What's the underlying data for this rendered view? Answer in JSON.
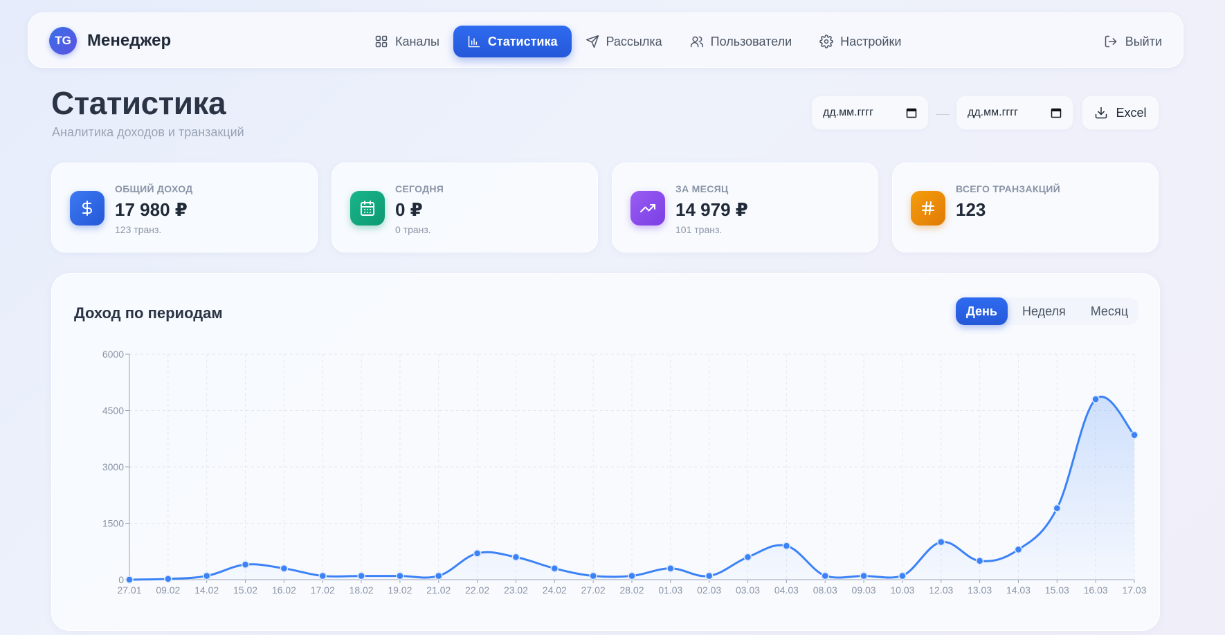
{
  "nav": {
    "logo": "TG",
    "app_name": "Менеджер",
    "items": [
      {
        "label": "Каналы",
        "icon": "grid-icon"
      },
      {
        "label": "Статистика",
        "icon": "bar-chart-icon",
        "active": true
      },
      {
        "label": "Рассылка",
        "icon": "send-icon"
      },
      {
        "label": "Пользователи",
        "icon": "users-icon"
      },
      {
        "label": "Настройки",
        "icon": "gear-icon"
      }
    ],
    "logout": "Выйти"
  },
  "header": {
    "title": "Статистика",
    "subtitle": "Аналитика доходов и транзакций",
    "date_from_placeholder": "дд.мм.гггг",
    "date_to_placeholder": "дд.мм.гггг",
    "export_label": "Excel"
  },
  "stats": [
    {
      "label": "ОБЩИЙ ДОХОД",
      "value": "17 980 ₽",
      "sub": "123 транз.",
      "icon": "dollar-icon",
      "color": "#2f6bf0"
    },
    {
      "label": "СЕГОДНЯ",
      "value": "0 ₽",
      "sub": "0 транз.",
      "icon": "calendar-icon",
      "color": "#14a87e"
    },
    {
      "label": "ЗА МЕСЯЦ",
      "value": "14 979 ₽",
      "sub": "101 транз.",
      "icon": "trending-up-icon",
      "color": "#8a4cec"
    },
    {
      "label": "ВСЕГО ТРАНЗАКЦИЙ",
      "value": "123",
      "sub": "",
      "icon": "hash-icon",
      "color": "#ea8a08"
    }
  ],
  "chart_panel": {
    "title": "Доход по периодам",
    "tabs": [
      "День",
      "Неделя",
      "Месяц"
    ],
    "active_tab": "День"
  },
  "chart_data": {
    "type": "area",
    "categories": [
      "27.01",
      "09.02",
      "14.02",
      "15.02",
      "16.02",
      "17.02",
      "18.02",
      "19.02",
      "21.02",
      "22.02",
      "23.02",
      "24.02",
      "27.02",
      "28.02",
      "01.03",
      "02.03",
      "03.03",
      "04.03",
      "08.03",
      "09.03",
      "10.03",
      "12.03",
      "13.03",
      "14.03",
      "15.03",
      "16.03",
      "17.03"
    ],
    "series": [
      {
        "values": [
          0,
          20,
          100,
          400,
          300,
          100,
          100,
          100,
          100,
          700,
          600,
          300,
          100,
          100,
          300,
          100,
          600,
          900,
          100,
          100,
          100,
          1000,
          500,
          800,
          1900,
          4800,
          3850
        ]
      }
    ],
    "yticks": [
      0,
      1500,
      3000,
      4500,
      6000
    ],
    "ylim": [
      0,
      6000
    ],
    "grid": true,
    "line_color": "#3b82f6"
  }
}
